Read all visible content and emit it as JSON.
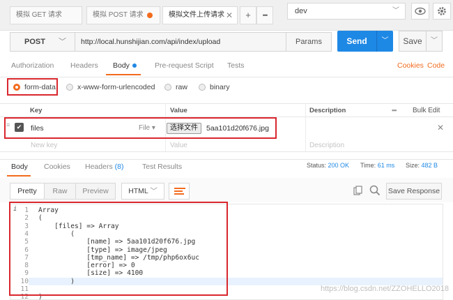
{
  "tabs": [
    {
      "label": "模拟 GET 请求"
    },
    {
      "label": "模拟 POST 请求"
    },
    {
      "label": "模拟文件上传请求"
    }
  ],
  "tab_add": "+",
  "tab_more": "•••",
  "environment": {
    "selected": "dev"
  },
  "request": {
    "method": "POST",
    "url": "http://local.hunshijian.com/api/index/upload",
    "params_label": "Params",
    "send_label": "Send",
    "save_label": "Save"
  },
  "request_tabs": [
    "Authorization",
    "Headers",
    "Body",
    "Pre-request Script",
    "Tests"
  ],
  "request_links": {
    "cookies": "Cookies",
    "code": "Code"
  },
  "body_modes": [
    "form-data",
    "x-www-form-urlencoded",
    "raw",
    "binary"
  ],
  "kv_table": {
    "headers": {
      "key": "Key",
      "value": "Value",
      "description": "Description"
    },
    "bulk_edit": "Bulk Edit",
    "more": "•••",
    "row": {
      "key": "files",
      "type": "File",
      "file_button": "选择文件",
      "file_name": "5aa101d20f676.jpg"
    },
    "placeholders": {
      "key": "New key",
      "value": "Value",
      "description": "Description"
    }
  },
  "response_tabs": [
    {
      "label": "Body"
    },
    {
      "label": "Cookies"
    },
    {
      "label": "Headers",
      "count": "(8)"
    },
    {
      "label": "Test Results"
    }
  ],
  "status": {
    "status_label": "Status:",
    "status_value": "200 OK",
    "time_label": "Time:",
    "time_value": "61 ms",
    "size_label": "Size:",
    "size_value": "482 B"
  },
  "view_modes": [
    "Pretty",
    "Raw",
    "Preview"
  ],
  "format": {
    "selected": "HTML"
  },
  "save_response_label": "Save Response",
  "code_lines": [
    "Array",
    "(",
    "    [files] => Array",
    "        (",
    "            [name] => 5aa101d20f676.jpg",
    "            [type] => image/jpeg",
    "            [tmp_name] => /tmp/php6ox6uc",
    "            [error] => 0",
    "            [size] => 4100",
    "        )",
    "",
    ")"
  ],
  "highlighted_line": 10,
  "watermark": "https://blog.csdn.net/ZZOHELLO2018",
  "colors": {
    "accent": "#f26b1d",
    "send": "#1e88e5",
    "annotation": "#d9272e",
    "status": "#1e88e5"
  }
}
